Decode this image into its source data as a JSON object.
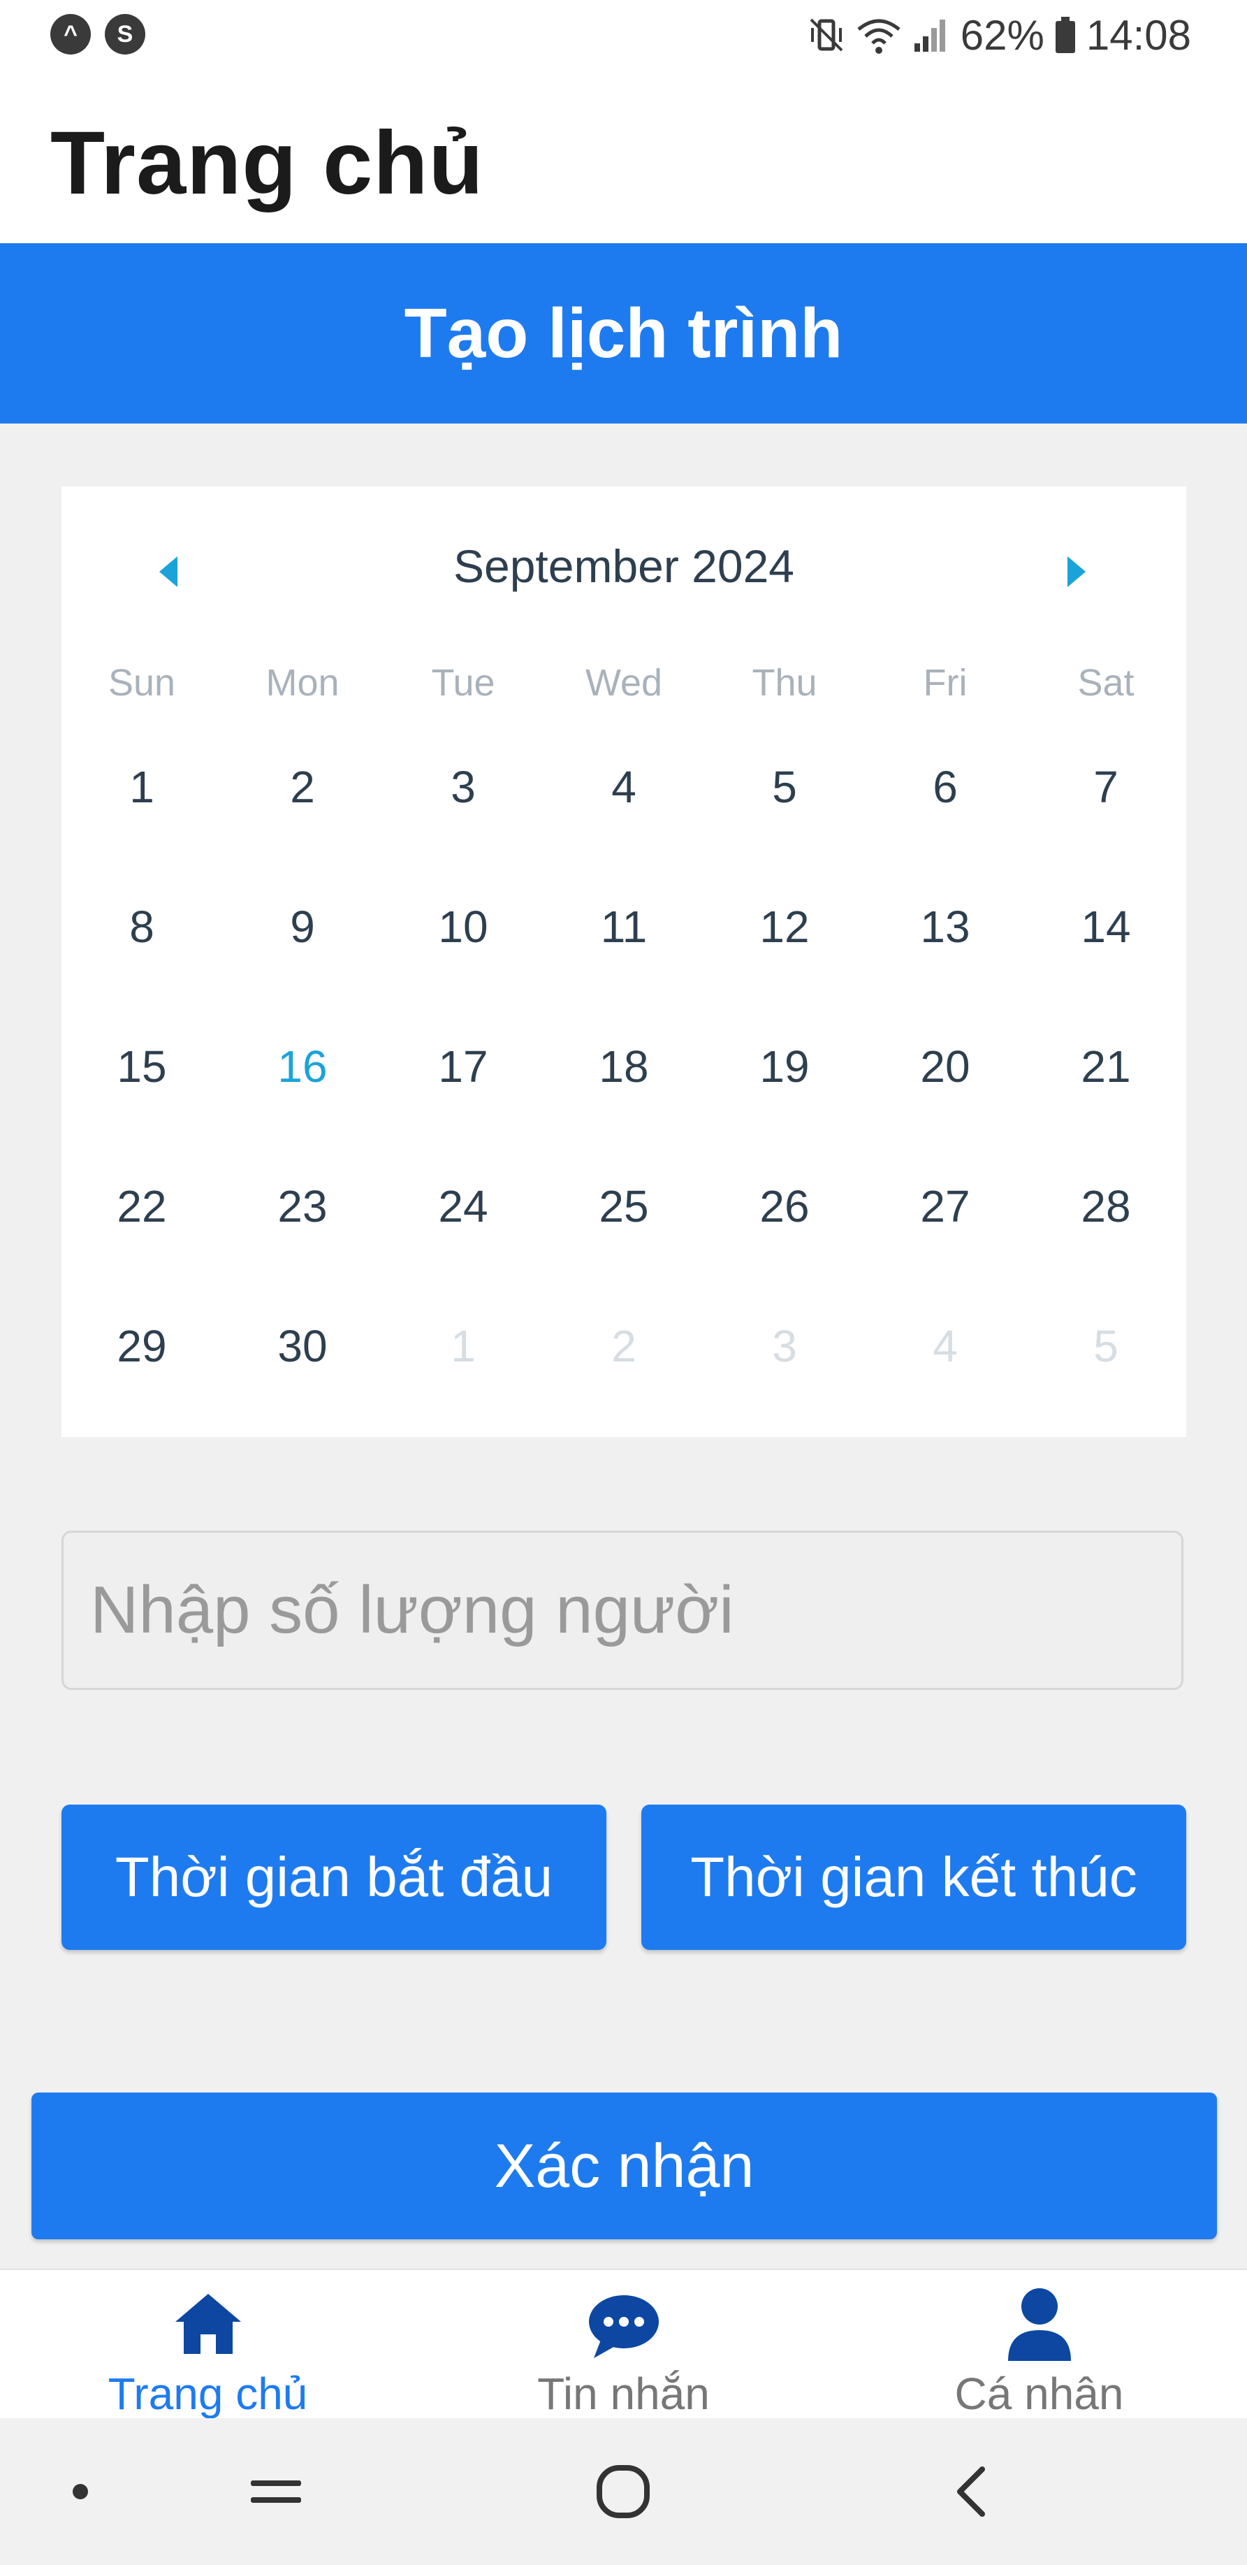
{
  "status_bar": {
    "battery": "62%",
    "time": "14:08",
    "left_icons": [
      "app-a-icon",
      "sync-icon"
    ],
    "right_icons": [
      "vibrate-icon",
      "wifi-icon",
      "signal-icon",
      "battery-icon"
    ]
  },
  "header": {
    "title": "Trang chủ"
  },
  "banner": {
    "title": "Tạo lịch trình"
  },
  "calendar": {
    "month_label": "September 2024",
    "weekdays": [
      "Sun",
      "Mon",
      "Tue",
      "Wed",
      "Thu",
      "Fri",
      "Sat"
    ],
    "weeks": [
      [
        "1",
        "2",
        "3",
        "4",
        "5",
        "6",
        "7"
      ],
      [
        "8",
        "9",
        "10",
        "11",
        "12",
        "13",
        "14"
      ],
      [
        "15",
        "16",
        "17",
        "18",
        "19",
        "20",
        "21"
      ],
      [
        "22",
        "23",
        "24",
        "25",
        "26",
        "27",
        "28"
      ],
      [
        "29",
        "30",
        "1",
        "2",
        "3",
        "4",
        "5"
      ]
    ],
    "today": "16",
    "accent_color": "#1aa3d9"
  },
  "form": {
    "people_placeholder": "Nhập số lượng người",
    "people_value": "",
    "start_time_label": "Thời gian bắt đầu",
    "end_time_label": "Thời gian kết thúc",
    "confirm_label": "Xác nhận"
  },
  "tabs": [
    {
      "label": "Trang chủ",
      "icon": "home-icon",
      "active": true
    },
    {
      "label": "Tin nhắn",
      "icon": "chat-icon",
      "active": false
    },
    {
      "label": "Cá nhân",
      "icon": "person-icon",
      "active": false
    }
  ],
  "colors": {
    "primary": "#1e7bef",
    "tab_icon": "#0d47a1"
  },
  "nav_bar": {
    "icons": [
      "dot-icon",
      "recents-icon",
      "home-circle-icon",
      "back-icon"
    ]
  }
}
